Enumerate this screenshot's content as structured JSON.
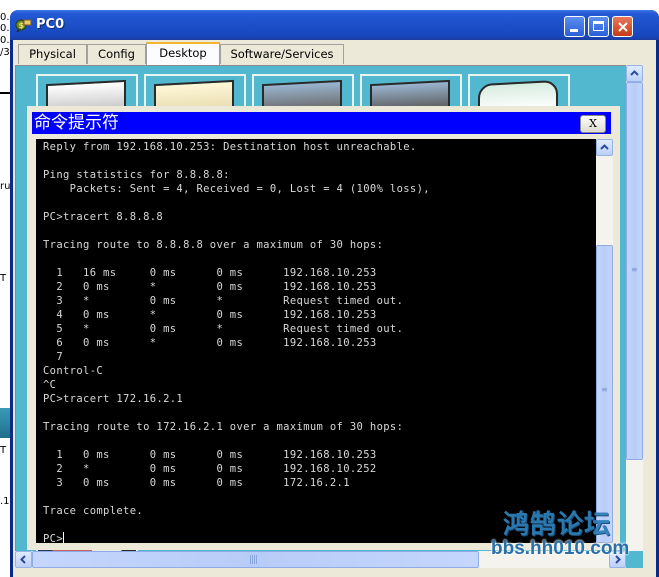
{
  "background": {
    "peek_texts": [
      "0.:",
      "0.:",
      "0.:",
      "/3",
      "ru",
      "T",
      "T",
      ".1"
    ]
  },
  "window": {
    "title": "PC0",
    "icon": "packet-tracer-pc-icon",
    "controls": {
      "minimize_icon": "minimize-icon",
      "maximize_icon": "maximize-icon",
      "close_icon": "close-icon"
    }
  },
  "tabs": [
    {
      "label": "Physical",
      "active": false
    },
    {
      "label": "Config",
      "active": false
    },
    {
      "label": "Desktop",
      "active": true
    },
    {
      "label": "Software/Services",
      "active": false
    }
  ],
  "desktop": {
    "app_tiles": [
      "ip-configuration-icon",
      "dial-up-icon",
      "terminal-icon",
      "command-prompt-icon",
      "web-browser-icon"
    ]
  },
  "command_prompt": {
    "title": "命令提示符",
    "close_label": "X",
    "lines": [
      "Reply from 192.168.10.253: Destination host unreachable.",
      "",
      "Ping statistics for 8.8.8.8:",
      "    Packets: Sent = 4, Received = 0, Lost = 4 (100% loss),",
      "",
      "PC>tracert 8.8.8.8",
      "",
      "Tracing route to 8.8.8.8 over a maximum of 30 hops:",
      "",
      "  1   16 ms     0 ms      0 ms      192.168.10.253",
      "  2   0 ms      *         0 ms      192.168.10.253",
      "  3   *         0 ms      *         Request timed out.",
      "  4   0 ms      *         0 ms      192.168.10.253",
      "  5   *         0 ms      *         Request timed out.",
      "  6   0 ms      *         0 ms      192.168.10.253",
      "  7",
      "Control-C",
      "^C",
      "PC>tracert 172.16.2.1",
      "",
      "Tracing route to 172.16.2.1 over a maximum of 30 hops:",
      "",
      "  1   0 ms      0 ms      0 ms      192.168.10.253",
      "  2   *         0 ms      0 ms      192.168.10.252",
      "  3   0 ms      0 ms      0 ms      172.16.2.1",
      "",
      "Trace complete.",
      "",
      "PC>"
    ]
  },
  "watermark": {
    "cn": "鸿鹄论坛",
    "en": "bbs.hh010.com"
  }
}
